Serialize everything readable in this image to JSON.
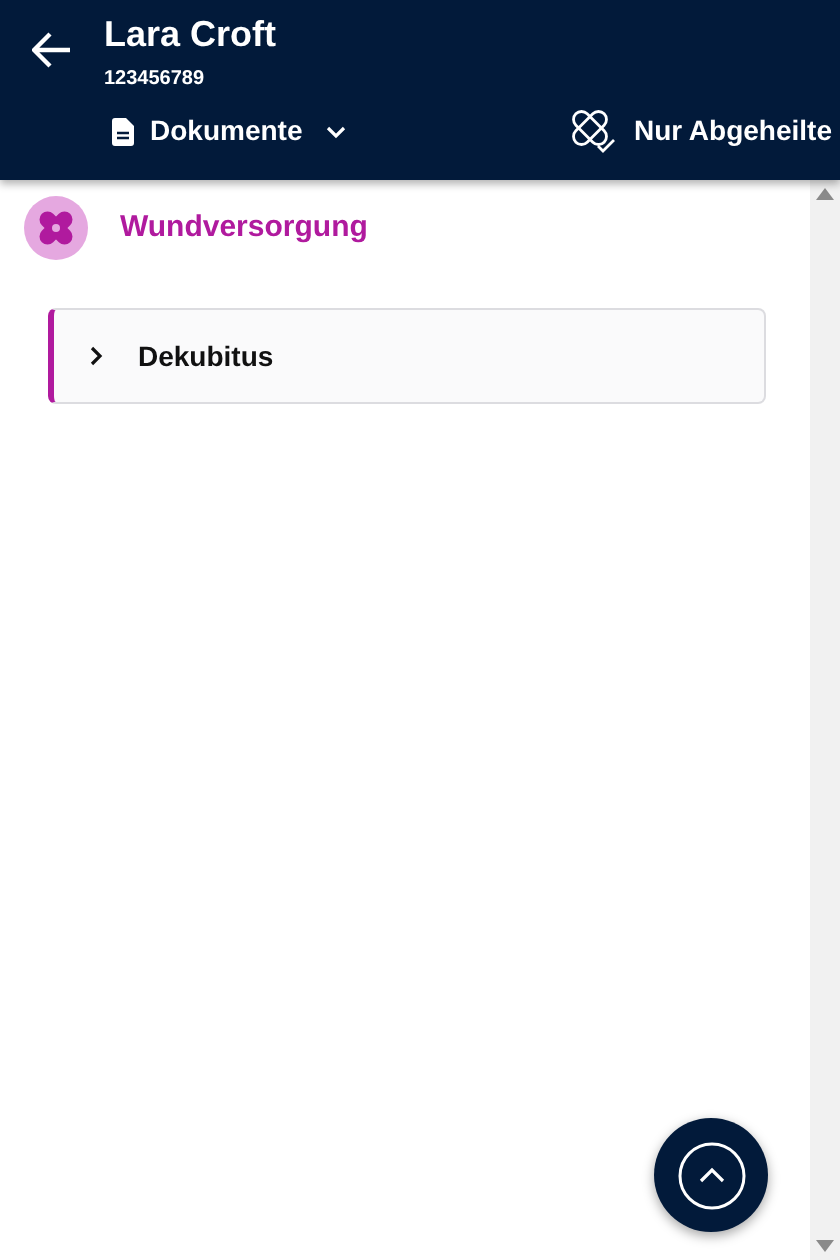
{
  "header": {
    "title": "Lara Croft",
    "subtitle": "123456789",
    "dropdown": {
      "label": "Dokumente",
      "expanded": false
    },
    "filter": {
      "label": "Nur Abgeheilte"
    }
  },
  "section": {
    "title": "Wundversorgung",
    "items": [
      {
        "label": "Dekubitus",
        "expanded": false
      }
    ]
  }
}
